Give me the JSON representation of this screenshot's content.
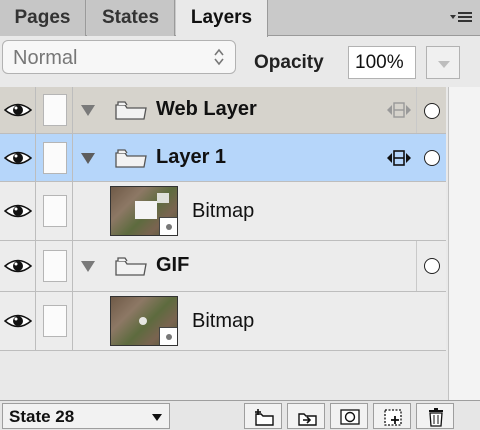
{
  "tabs": [
    {
      "label": "Pages",
      "active": false
    },
    {
      "label": "States",
      "active": false
    },
    {
      "label": "Layers",
      "active": true
    }
  ],
  "options": {
    "blend_mode": "Normal",
    "opacity_label": "Opacity",
    "opacity_value": "100%"
  },
  "layers": [
    {
      "name": "Web Layer",
      "kind": "web-layer",
      "visible": true,
      "expanded": true,
      "selected": false
    },
    {
      "name": "Layer 1",
      "kind": "layer",
      "visible": true,
      "expanded": true,
      "selected": true
    },
    {
      "name": "Bitmap",
      "kind": "bitmap",
      "visible": true
    },
    {
      "name": "GIF",
      "kind": "layer",
      "visible": true,
      "expanded": true,
      "selected": false
    },
    {
      "name": "Bitmap",
      "kind": "bitmap",
      "visible": true
    }
  ],
  "status": {
    "state": "State 28"
  },
  "icons": {
    "visibility": "eye-icon",
    "expand": "triangle-down-icon",
    "folder": "folder-icon",
    "move": "move-arrows-icon",
    "options": "panel-menu-icon"
  },
  "colors": {
    "selected_row": "#b6d6fa",
    "web_layer_row": "#d6d3cc"
  }
}
